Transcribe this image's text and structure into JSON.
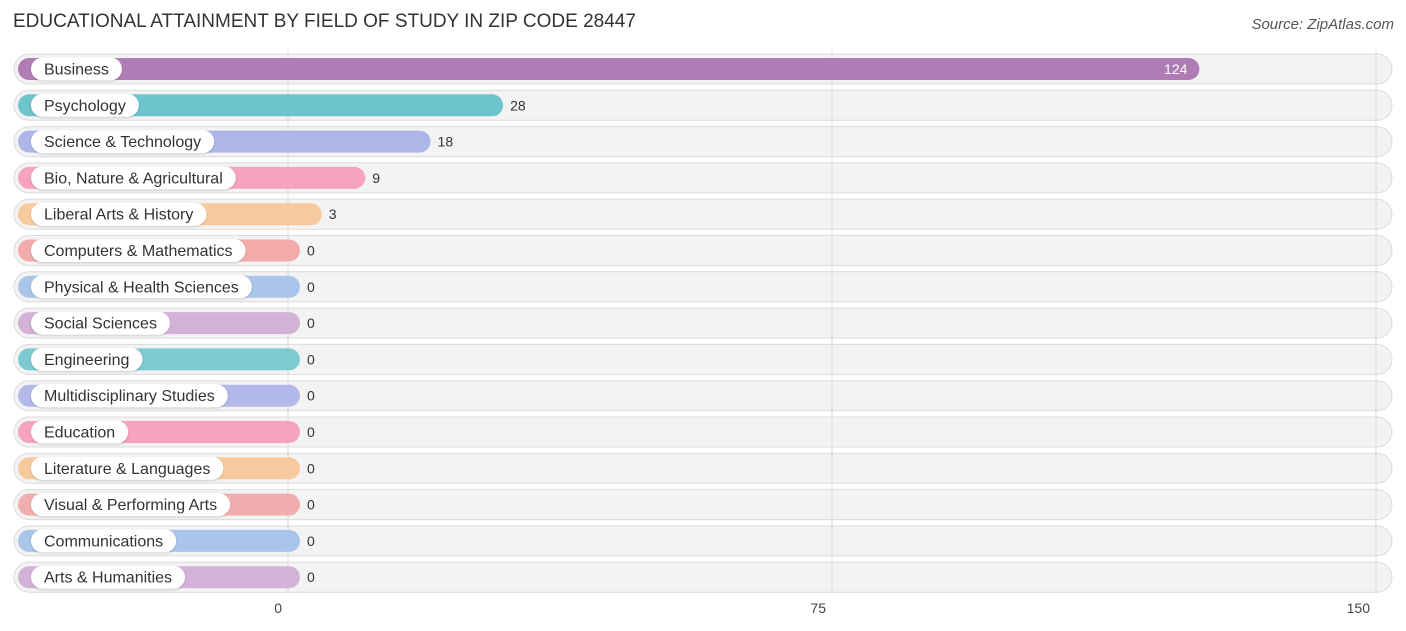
{
  "header": {
    "title": "EDUCATIONAL ATTAINMENT BY FIELD OF STUDY IN ZIP CODE 28447",
    "source": "Source: ZipAtlas.com"
  },
  "chart_data": {
    "type": "bar",
    "orientation": "horizontal",
    "title": "EDUCATIONAL ATTAINMENT BY FIELD OF STUDY IN ZIP CODE 28447",
    "xlabel": "",
    "ylabel": "",
    "xlim": [
      0,
      150
    ],
    "xticks": [
      0,
      75,
      150
    ],
    "grid": true,
    "legend": "none",
    "categories": [
      "Business",
      "Psychology",
      "Science & Technology",
      "Bio, Nature & Agricultural",
      "Liberal Arts & History",
      "Computers & Mathematics",
      "Physical & Health Sciences",
      "Social Sciences",
      "Engineering",
      "Multidisciplinary Studies",
      "Education",
      "Literature & Languages",
      "Visual & Performing Arts",
      "Communications",
      "Arts & Humanities"
    ],
    "values": [
      124,
      28,
      18,
      9,
      3,
      0,
      0,
      0,
      0,
      0,
      0,
      0,
      0,
      0,
      0
    ],
    "colors": [
      "#b07cb5",
      "#6ec4cb",
      "#adb6e8",
      "#f5a3bf",
      "#f9c99e",
      "#f2aaaa",
      "#a9c6ea",
      "#d2b2d6",
      "#7dcbd0",
      "#b3b9e8",
      "#f5a3bf",
      "#f9c99e",
      "#f1aeae",
      "#a9c6ea",
      "#d2b2d6"
    ]
  }
}
